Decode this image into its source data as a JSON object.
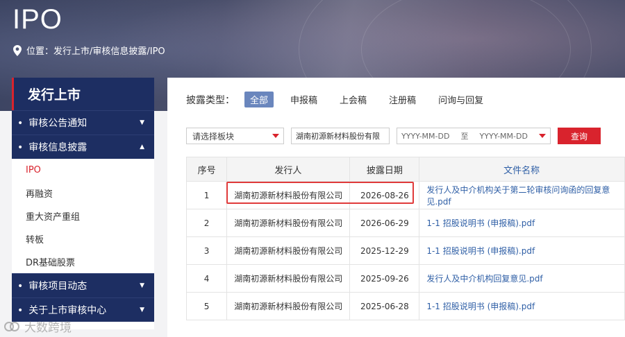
{
  "banner": {
    "title": "IPO",
    "breadcrumb": "位置：发行上市/审核信息披露/IPO"
  },
  "sidebar": {
    "heading": "发行上市",
    "groups": [
      {
        "label": "审核公告通知",
        "expanded": false
      },
      {
        "label": "审核信息披露",
        "expanded": true
      },
      {
        "label": "审核项目动态",
        "expanded": false
      },
      {
        "label": "关于上市审核中心",
        "expanded": false
      }
    ],
    "items": [
      "IPO",
      "再融资",
      "重大资产重组",
      "转板",
      "DR基础股票"
    ],
    "active_item": "IPO"
  },
  "filter": {
    "label": "披露类型：",
    "tabs": [
      "全部",
      "申报稿",
      "上会稿",
      "注册稿",
      "问询与回复"
    ],
    "active_tab": "全部"
  },
  "search": {
    "board_placeholder": "请选择板块",
    "company_value": "湖南初源新材料股份有限",
    "date_from_placeholder": "YYYY-MM-DD",
    "date_sep": "至",
    "date_to_placeholder": "YYYY-MM-DD",
    "query_label": "查询"
  },
  "table": {
    "headers": [
      "序号",
      "发行人",
      "披露日期",
      "文件名称"
    ],
    "rows": [
      {
        "no": "1",
        "issuer": "湖南初源新材料股份有限公司",
        "date": "2026-08-26",
        "file": "发行人及中介机构关于第二轮审核问询函的回复意见.pdf"
      },
      {
        "no": "2",
        "issuer": "湖南初源新材料股份有限公司",
        "date": "2026-06-29",
        "file": "1-1 招股说明书 (申报稿).pdf"
      },
      {
        "no": "3",
        "issuer": "湖南初源新材料股份有限公司",
        "date": "2025-12-29",
        "file": "1-1 招股说明书 (申报稿).pdf"
      },
      {
        "no": "4",
        "issuer": "湖南初源新材料股份有限公司",
        "date": "2025-09-26",
        "file": "发行人及中介机构回复意见.pdf"
      },
      {
        "no": "5",
        "issuer": "湖南初源新材料股份有限公司",
        "date": "2025-06-28",
        "file": "1-1 招股说明书 (申报稿).pdf"
      }
    ]
  },
  "watermark": {
    "text": "大数跨境"
  },
  "colors": {
    "navy": "#1d2e62",
    "accent_red": "#d9232d",
    "tab_active": "#6a86bd",
    "link": "#2f5fa6"
  }
}
